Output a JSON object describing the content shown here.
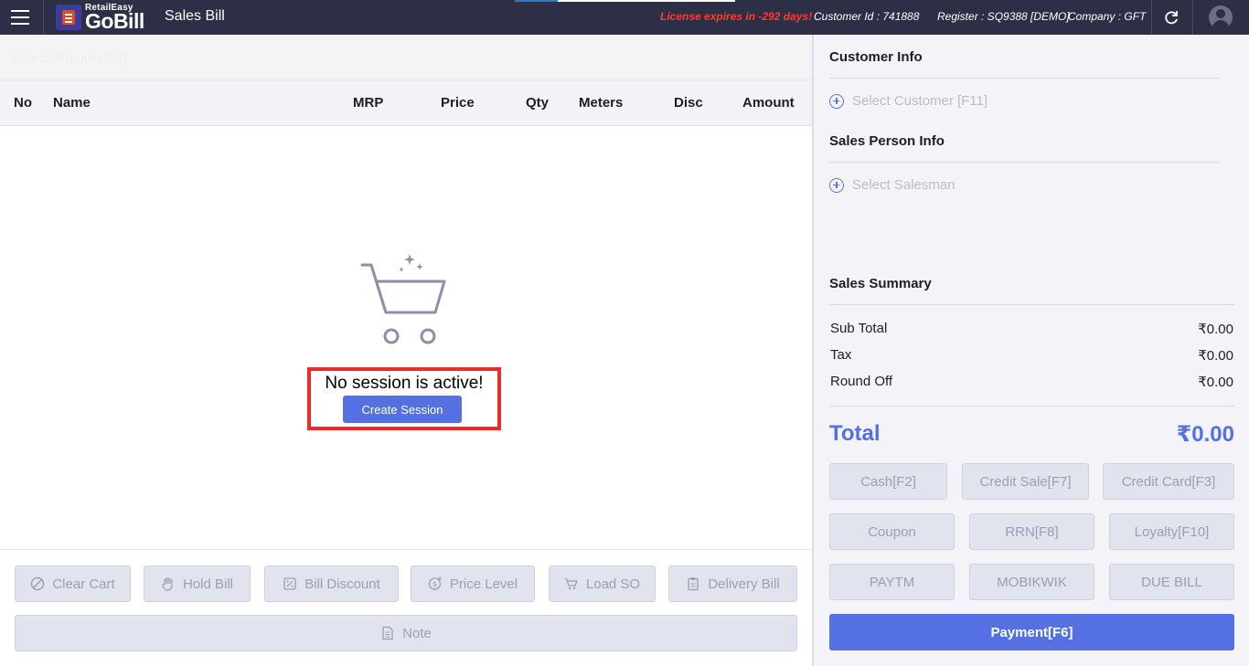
{
  "topbar": {
    "brand_small": "RetailEasy",
    "brand_big": "GoBill",
    "title": "Sales Bill",
    "license": "License expires in -292 days!",
    "customer_id": "Customer Id : 741888",
    "register": "Register : SQ9388 [DEMO]",
    "company": "Company : GFT"
  },
  "search": {
    "placeholder": "Search Product [F4]"
  },
  "table": {
    "columns": [
      "No",
      "Name",
      "MRP",
      "Price",
      "Qty",
      "Meters",
      "Disc",
      "Amount"
    ]
  },
  "empty_state": {
    "message": "No session is active!",
    "create_button": "Create Session"
  },
  "actions": {
    "clear_cart": "Clear Cart",
    "hold_bill": "Hold Bill",
    "bill_discount": "Bill Discount",
    "price_level": "Price Level",
    "load_so": "Load SO",
    "delivery_bill": "Delivery Bill",
    "note": "Note"
  },
  "customer_info": {
    "title": "Customer Info",
    "select": "Select Customer [F11]"
  },
  "sales_person_info": {
    "title": "Sales Person Info",
    "select": "Select Salesman"
  },
  "summary": {
    "title": "Sales Summary",
    "rows": [
      {
        "label": "Sub Total",
        "value": "₹0.00"
      },
      {
        "label": "Tax",
        "value": "₹0.00"
      },
      {
        "label": "Round Off",
        "value": "₹0.00"
      }
    ],
    "total_label": "Total",
    "total_value": "₹0.00"
  },
  "payment_methods": {
    "row1": [
      "Cash[F2]",
      "Credit Sale[F7]",
      "Credit Card[F3]"
    ],
    "row2": [
      "Coupon",
      "RRN[F8]",
      "Loyalty[F10]"
    ],
    "row3": [
      "PAYTM",
      "MOBIKWIK",
      "DUE BILL"
    ],
    "payment": "Payment[F6]"
  },
  "colors": {
    "topbar": "#2c2f45",
    "accent": "#5470e2",
    "license_warning": "#ff3b30",
    "highlight_border": "#ee2b2b"
  }
}
